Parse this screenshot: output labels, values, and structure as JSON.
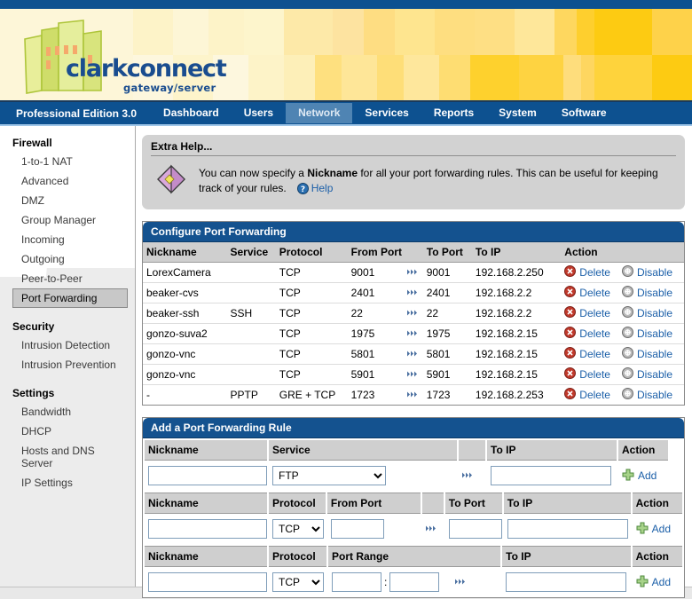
{
  "header": {
    "product_name": "clarkconnect",
    "product_tagline": "gateway/server",
    "edition": "Professional Edition 3.0"
  },
  "nav": {
    "items": [
      {
        "label": "Dashboard",
        "active": false
      },
      {
        "label": "Users",
        "active": false
      },
      {
        "label": "Network",
        "active": true
      },
      {
        "label": "Services",
        "active": false
      },
      {
        "label": "Reports",
        "active": false
      },
      {
        "label": "System",
        "active": false
      },
      {
        "label": "Software",
        "active": false
      }
    ]
  },
  "sidebar": {
    "groups": [
      {
        "title": "Firewall",
        "items": [
          {
            "label": "1-to-1 NAT",
            "selected": false
          },
          {
            "label": "Advanced",
            "selected": false
          },
          {
            "label": "DMZ",
            "selected": false
          },
          {
            "label": "Group Manager",
            "selected": false
          },
          {
            "label": "Incoming",
            "selected": false
          },
          {
            "label": "Outgoing",
            "selected": false
          },
          {
            "label": "Peer-to-Peer",
            "selected": false
          },
          {
            "label": "Port Forwarding",
            "selected": true
          }
        ]
      },
      {
        "title": "Security",
        "items": [
          {
            "label": "Intrusion Detection",
            "selected": false
          },
          {
            "label": "Intrusion Prevention",
            "selected": false
          }
        ]
      },
      {
        "title": "Settings",
        "items": [
          {
            "label": "Bandwidth",
            "selected": false
          },
          {
            "label": "DHCP",
            "selected": false
          },
          {
            "label": "Hosts and DNS Server",
            "selected": false
          },
          {
            "label": "IP Settings",
            "selected": false
          }
        ]
      }
    ]
  },
  "help": {
    "title": "Extra Help...",
    "text_part1": "You can now specify a ",
    "text_bold": "Nickname",
    "text_part2": " for all your port forwarding rules.  This can be useful for keeping track of your rules.",
    "link_label": "Help",
    "icon": "book-icon",
    "question_icon": "question-mark-icon"
  },
  "configure_panel": {
    "title": "Configure Port Forwarding",
    "columns": [
      "Nickname",
      "Service",
      "Protocol",
      "From Port",
      "",
      "To Port",
      "To IP",
      "Action"
    ],
    "delete_label": "Delete",
    "disable_label": "Disable",
    "rows": [
      {
        "nickname": "LorexCamera",
        "service": "",
        "protocol": "TCP",
        "from_port": "9001",
        "to_port": "9001",
        "to_ip": "192.168.2.250"
      },
      {
        "nickname": "beaker-cvs",
        "service": "",
        "protocol": "TCP",
        "from_port": "2401",
        "to_port": "2401",
        "to_ip": "192.168.2.2"
      },
      {
        "nickname": "beaker-ssh",
        "service": "SSH",
        "protocol": "TCP",
        "from_port": "22",
        "to_port": "22",
        "to_ip": "192.168.2.2"
      },
      {
        "nickname": "gonzo-suva2",
        "service": "",
        "protocol": "TCP",
        "from_port": "1975",
        "to_port": "1975",
        "to_ip": "192.168.2.15"
      },
      {
        "nickname": "gonzo-vnc",
        "service": "",
        "protocol": "TCP",
        "from_port": "5801",
        "to_port": "5801",
        "to_ip": "192.168.2.15"
      },
      {
        "nickname": "gonzo-vnc",
        "service": "",
        "protocol": "TCP",
        "from_port": "5901",
        "to_port": "5901",
        "to_ip": "192.168.2.15"
      },
      {
        "nickname": "-",
        "service": "PPTP",
        "protocol": "GRE + TCP",
        "from_port": "1723",
        "to_port": "1723",
        "to_ip": "192.168.2.253"
      }
    ]
  },
  "add_panel": {
    "title": "Add a Port Forwarding Rule",
    "add_label": "Add",
    "service_form": {
      "col_nickname": "Nickname",
      "col_service": "Service",
      "col_toip": "To IP",
      "col_action": "Action",
      "nickname_value": "",
      "service_selected": "FTP",
      "service_options": [
        "FTP"
      ],
      "toip_value": ""
    },
    "port_form": {
      "col_nickname": "Nickname",
      "col_protocol": "Protocol",
      "col_fromport": "From Port",
      "col_toport": "To Port",
      "col_toip": "To IP",
      "col_action": "Action",
      "nickname_value": "",
      "protocol_selected": "TCP",
      "protocol_options": [
        "TCP"
      ],
      "fromport_value": "",
      "toport_value": "",
      "toip_value": ""
    },
    "range_form": {
      "col_nickname": "Nickname",
      "col_protocol": "Protocol",
      "col_portrange": "Port Range",
      "col_toip": "To IP",
      "col_action": "Action",
      "nickname_value": "",
      "protocol_selected": "TCP",
      "protocol_options": [
        "TCP"
      ],
      "range_start_value": "",
      "range_separator": ":",
      "range_end_value": "",
      "toip_value": ""
    }
  },
  "colors": {
    "nav_blue": "#0d5190",
    "panel_blue": "#14528f",
    "link_blue": "#1b5fa8",
    "banner_yellow": "#ffd200",
    "logo_green": "#b5cc3e",
    "selected_gray": "#c8c8c8"
  }
}
